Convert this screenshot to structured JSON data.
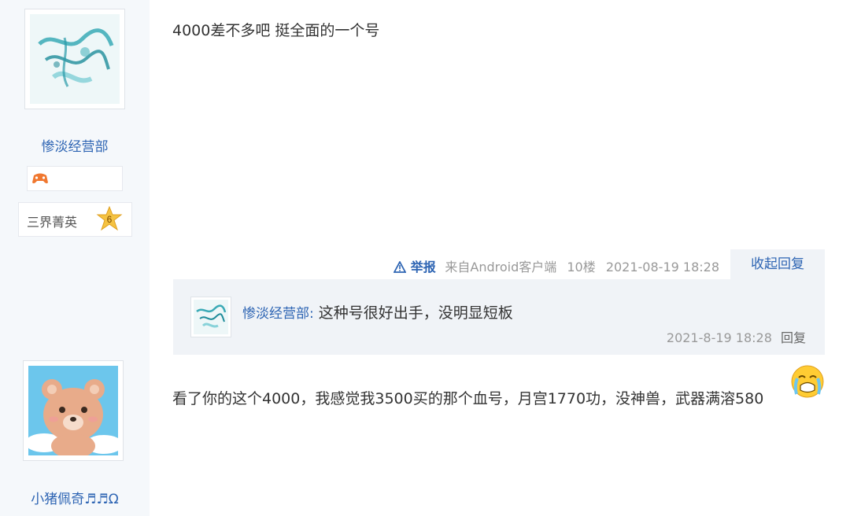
{
  "posts": [
    {
      "author": {
        "name": "惨淡经营部",
        "level_title": "三界菁英",
        "level": "6"
      },
      "content": "4000差不多吧 挺全面的一个号",
      "meta": {
        "report_label": "举报",
        "source": "来自Android客户端",
        "floor": "10楼",
        "timestamp": "2021-08-19 18:28",
        "collapse_label": "收起回复"
      },
      "replies": [
        {
          "user": "惨淡经营部",
          "separator": ":",
          "content": " 这种号很好出手，没明显短板",
          "timestamp": "2021-8-19 18:28",
          "reply_label": "回复"
        }
      ]
    },
    {
      "author": {
        "name": "小猪佩奇♬♬Ω"
      },
      "content": "看了你的这个4000，我感觉我3500买的那个血号，月宫1770功，没神兽，武器满溶580"
    }
  ],
  "colors": {
    "link": "#2d64b3",
    "meta": "#999999",
    "sidebar_bg": "#f5f8fb",
    "reply_bg": "#f0f3f7"
  },
  "icons": [
    "water-art-avatar",
    "game-controller-icon",
    "level-star-icon",
    "warning-triangle-icon",
    "bear-avatar",
    "crying-emoji-icon"
  ]
}
